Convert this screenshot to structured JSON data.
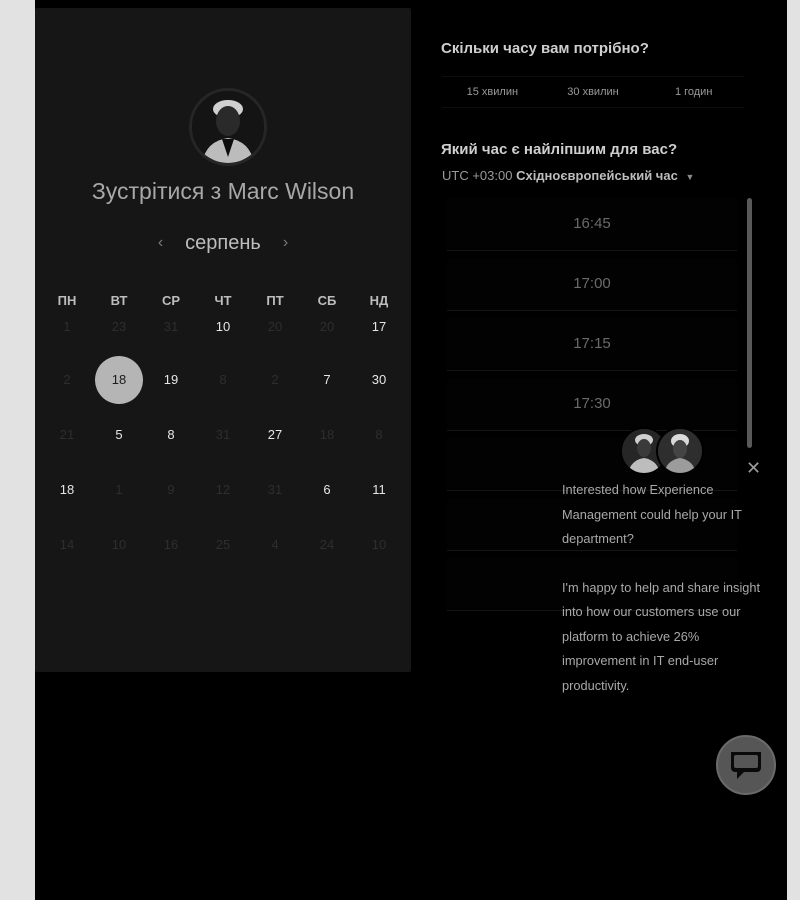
{
  "meeting": {
    "title": "Зустрітися з Marc Wilson",
    "month": "серпень",
    "weekdays": [
      "ПН",
      "ВТ",
      "СР",
      "ЧТ",
      "ПТ",
      "СБ",
      "НД"
    ],
    "weeks": [
      [
        {
          "d": "1",
          "a": false
        },
        {
          "d": "23",
          "a": false
        },
        {
          "d": "31",
          "a": false
        },
        {
          "d": "10",
          "a": true
        },
        {
          "d": "20",
          "a": false
        },
        {
          "d": "20",
          "a": false
        },
        {
          "d": "17",
          "a": true
        }
      ],
      [
        {
          "d": "2",
          "a": false
        },
        {
          "d": "18",
          "a": true,
          "selected": true
        },
        {
          "d": "19",
          "a": true
        },
        {
          "d": "8",
          "a": false
        },
        {
          "d": "2",
          "a": false
        },
        {
          "d": "7",
          "a": true
        },
        {
          "d": "30",
          "a": true
        }
      ],
      [
        {
          "d": "21",
          "a": false
        },
        {
          "d": "5",
          "a": true
        },
        {
          "d": "8",
          "a": true
        },
        {
          "d": "31",
          "a": false
        },
        {
          "d": "27",
          "a": true
        },
        {
          "d": "18",
          "a": false
        },
        {
          "d": "8",
          "a": false
        }
      ],
      [
        {
          "d": "18",
          "a": true
        },
        {
          "d": "1",
          "a": false
        },
        {
          "d": "9",
          "a": false
        },
        {
          "d": "12",
          "a": false
        },
        {
          "d": "31",
          "a": false
        },
        {
          "d": "6",
          "a": true
        },
        {
          "d": "11",
          "a": true
        }
      ],
      [
        {
          "d": "14",
          "a": false
        },
        {
          "d": "10",
          "a": false
        },
        {
          "d": "16",
          "a": false
        },
        {
          "d": "25",
          "a": false
        },
        {
          "d": "4",
          "a": false
        },
        {
          "d": "24",
          "a": false
        },
        {
          "d": "10",
          "a": false
        }
      ]
    ]
  },
  "duration": {
    "question": "Скільки часу вам потрібно?",
    "options": [
      "15 хвилин",
      "30 хвилин",
      "1 годин"
    ]
  },
  "time": {
    "question": "Який час є найліпшим для вас?",
    "tz_prefix": "UTC +03:00",
    "tz_name": "Східноєвропейський час",
    "slots": [
      "16:45",
      "17:00",
      "17:15",
      "17:30",
      "",
      "",
      ""
    ]
  },
  "chat": {
    "message1": "Interested how Experience Management could help your IT department?",
    "message2": "I'm happy to help and share insight into how our customers use our platform to achieve 26% improvement in IT end-user productivity."
  }
}
